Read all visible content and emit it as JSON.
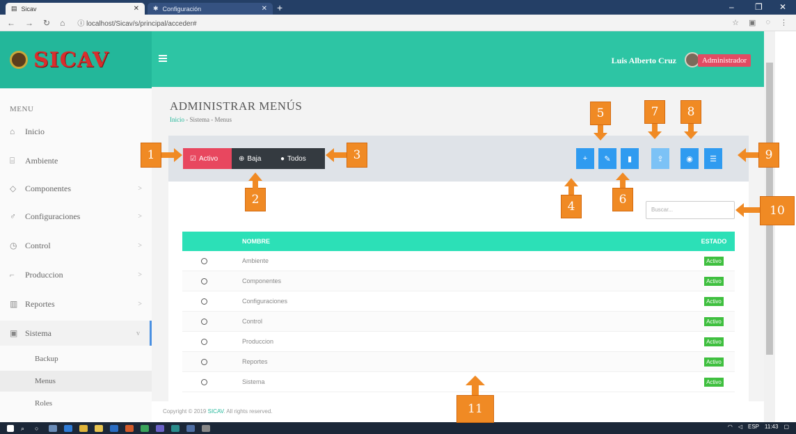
{
  "browser": {
    "tab1_title": "Sicav",
    "tab2_title": "Configuración",
    "url": "localhost/Sicav/s/principal/acceder#"
  },
  "brand": {
    "name": "SICAV"
  },
  "topbar": {
    "user_name": "Luis Alberto Cruz",
    "role": "Administrador"
  },
  "sidebar": {
    "menu_title": "MENU",
    "items": [
      {
        "label": "Inicio",
        "icon": "home-icon",
        "chevron": ""
      },
      {
        "label": "Ambiente",
        "icon": "bank-icon",
        "chevron": ""
      },
      {
        "label": "Componentes",
        "icon": "cube-icon",
        "chevron": ">"
      },
      {
        "label": "Configuraciones",
        "icon": "wrench-icon",
        "chevron": ">"
      },
      {
        "label": "Control",
        "icon": "clock-icon",
        "chevron": ">"
      },
      {
        "label": "Produccion",
        "icon": "chart-icon",
        "chevron": ">"
      },
      {
        "label": "Reportes",
        "icon": "report-icon",
        "chevron": ">"
      },
      {
        "label": "Sistema",
        "icon": "window-icon",
        "chevron": "v"
      }
    ],
    "subitems": [
      "Backup",
      "Menus",
      "Roles"
    ]
  },
  "page": {
    "title": "ADMINISTRAR MENÚS",
    "breadcrumb": [
      "Inicio",
      "Sistema",
      "Menus"
    ],
    "breadcrumb_sep": "-"
  },
  "filters": {
    "active": "Activo",
    "baja": "Baja",
    "todos": "Todos"
  },
  "toolbar_buttons": [
    "add-icon",
    "edit-icon",
    "delete-icon",
    "export-icon",
    "view-icon",
    "list-icon"
  ],
  "search": {
    "placeholder": "Buscar..."
  },
  "table": {
    "headers": [
      "",
      "NOMBRE",
      "ESTADO"
    ],
    "rows": [
      {
        "name": "Ambiente",
        "estado": "Activo"
      },
      {
        "name": "Componentes",
        "estado": "Activo"
      },
      {
        "name": "Configuraciones",
        "estado": "Activo"
      },
      {
        "name": "Control",
        "estado": "Activo"
      },
      {
        "name": "Produccion",
        "estado": "Activo"
      },
      {
        "name": "Reportes",
        "estado": "Activo"
      },
      {
        "name": "Sistema",
        "estado": "Activo"
      }
    ]
  },
  "footer": {
    "text": "Copyright © 2019 ",
    "brand": "SICAV",
    "suffix": ". All rights reserved."
  },
  "taskbar": {
    "lang": "ESP",
    "time": "11:43"
  },
  "annotations": [
    "1",
    "2",
    "3",
    "4",
    "5",
    "6",
    "7",
    "8",
    "9",
    "10",
    "11"
  ],
  "colors": {
    "teal": "#2dc5a4",
    "active_red": "#e8475f",
    "primary_blue": "#2f9bf0",
    "annotation_orange": "#f08a24",
    "badge_green": "#3fbf3f"
  }
}
